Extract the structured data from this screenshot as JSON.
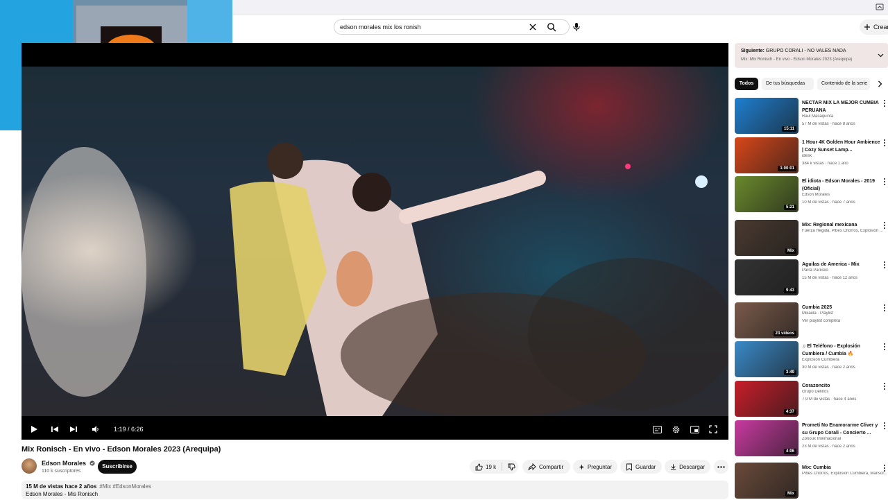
{
  "search": {
    "value": "edson morales mix los ronish"
  },
  "header": {
    "create_label": "Crear"
  },
  "player": {
    "time": "1:19 / 6:26",
    "progress_fraction": 0.2047,
    "buffer_fraction": 0.462
  },
  "video": {
    "title": "Mix Ronisch - En vivo - Edson Morales 2023 (Arequipa)",
    "channel": "Edson Morales",
    "subscribers": "110 k suscriptores",
    "subscribe_label": "Suscribirse",
    "likes": "19 k",
    "share_label": "Compartir",
    "ask_label": "Preguntar",
    "save_label": "Guardar",
    "download_label": "Descargar"
  },
  "description": {
    "stats": "15 M de vistas  hace 2 años",
    "tags": "#Mix #EdsonMorales",
    "line2": "Edson Morales - Mis Ronisch"
  },
  "next_up": {
    "label": "Siguiente:",
    "title": "GRUPO CORALI - NO VALES NADA",
    "sub": "Mix: Mix Ronisch - En vivo - Edson Morales 2023 (Arequipa)"
  },
  "chips": [
    "Todos",
    "De tus búsquedas",
    "Contenido de la serie"
  ],
  "recommendations": [
    {
      "title": "NECTAR MIX LA MEJOR CUMBIA PERUANA",
      "channel": "Raul Masaquinta",
      "meta": "57 M de vistas · hace 8 años",
      "badge": "15:11",
      "thumb_color": "#1f7fd0"
    },
    {
      "title": "1 Hour 4K Golden Hour Ambience | Cozy Sunset Lamp...",
      "channel": "idesk",
      "meta": "384 k vistas · hace 1 año",
      "badge": "1:00:01",
      "thumb_color": "#d8471a"
    },
    {
      "title": "El idiota - Edson Morales - 2019 (Oficial)",
      "channel": "Edson Morales",
      "meta": "10 M de vistas · hace 7 años",
      "badge": "5:21",
      "thumb_color": "#6a8a2c"
    },
    {
      "title": "Mix: Regional mexicana",
      "channel": "Fuerza Regida, Pibes Chorros, Explosion ...",
      "meta": "",
      "badge": "Mix",
      "thumb_color": "#4a3a30"
    },
    {
      "title": "Aguilas de America - Mix",
      "channel": "Parra Pariisko",
      "meta": "15 M de vistas · hace 12 años",
      "badge": "9:43",
      "thumb_color": "#333333"
    },
    {
      "title": "Cumbia 2025",
      "channel": "Mikaela · Playlist",
      "meta": "Ver playlist completa",
      "badge": "23 videos",
      "thumb_color": "#7a5a4a"
    },
    {
      "title": "♫ El Teléfono - Explosión Cumbiera / Cumbia 🔥",
      "channel": "Explosión Cumbiera",
      "meta": "30 M de vistas · hace 2 años",
      "badge": "3:49",
      "thumb_color": "#3a8ac8"
    },
    {
      "title": "Corazoncito",
      "channel": "Grupo Delirios",
      "meta": "7.9 M de vistas · hace 4 años",
      "badge": "4:37",
      "thumb_color": "#c81e2a"
    },
    {
      "title": "Prometí No Enamorarme Cliver y su Grupo Corali - Concierto ...",
      "channel": "Zonoux Internacional",
      "meta": "23 M de vistas · hace 2 años",
      "badge": "4:06",
      "thumb_color": "#c83aa0"
    },
    {
      "title": "Mix: Cumbia",
      "channel": "Pibes Chorros, Explosion Cumbiera, Marisol...",
      "meta": "",
      "badge": "Mix",
      "thumb_color": "#6a4a3a"
    }
  ],
  "colors": {
    "accent": "#ff0000",
    "chip_active": "#0f0f0f",
    "next_bg": "#f0e6e6"
  }
}
